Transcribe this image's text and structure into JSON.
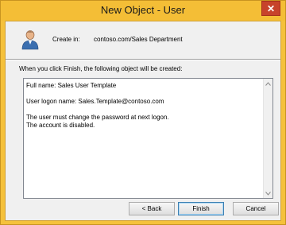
{
  "window": {
    "title": "New Object - User",
    "close_symbol": "✕",
    "close_icon": "close-icon"
  },
  "header": {
    "icon": "user-icon",
    "create_in_label": "Create in:",
    "create_in_value": "contoso.com/Sales Department"
  },
  "intro": "When you click Finish, the following object will be created:",
  "summary": {
    "lines": [
      "Full name: Sales User Template",
      "",
      "User logon name: Sales.Template@contoso.com",
      "",
      "The user must change the password at next logon.",
      "The account is disabled."
    ]
  },
  "buttons": {
    "back": "< Back",
    "finish": "Finish",
    "cancel": "Cancel"
  },
  "colors": {
    "titlebar": "#f4be36",
    "close_button": "#c7432b",
    "dialog_bg": "#f0f0f0"
  }
}
